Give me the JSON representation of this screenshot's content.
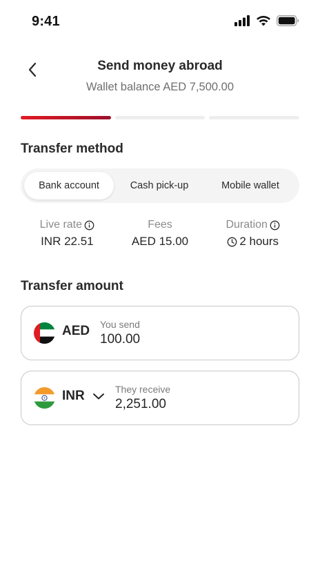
{
  "status_bar": {
    "time": "9:41",
    "icons": [
      "cellular-signal-icon",
      "wifi-icon",
      "battery-icon"
    ]
  },
  "header": {
    "back_icon": "chevron-left-icon",
    "title": "Send money abroad",
    "subtitle": "Wallet balance AED 7,500.00"
  },
  "progress": {
    "current_step": 1,
    "total_steps": 3,
    "active_color": "#e21a22"
  },
  "transfer_method": {
    "title": "Transfer method",
    "options": [
      "Bank account",
      "Cash pick-up",
      "Mobile wallet"
    ],
    "selected": "Bank account"
  },
  "info": {
    "live_rate_label": "Live rate",
    "live_rate_value": "INR 22.51",
    "fees_label": "Fees",
    "fees_value": "AED 15.00",
    "duration_label": "Duration",
    "duration_value": "2 hours"
  },
  "transfer_amount": {
    "title": "Transfer amount",
    "send": {
      "currency": "AED",
      "label": "You send",
      "amount": "100.00",
      "flag_icon": "uae-flag-icon"
    },
    "receive": {
      "currency": "INR",
      "label": "They receive",
      "amount": "2,251.00",
      "flag_icon": "india-flag-icon"
    }
  },
  "colors": {
    "accent": "#e21a22",
    "accent_dark": "#9e0f2d",
    "text_primary": "#2a2a2a",
    "text_secondary": "#6f6f6f"
  }
}
